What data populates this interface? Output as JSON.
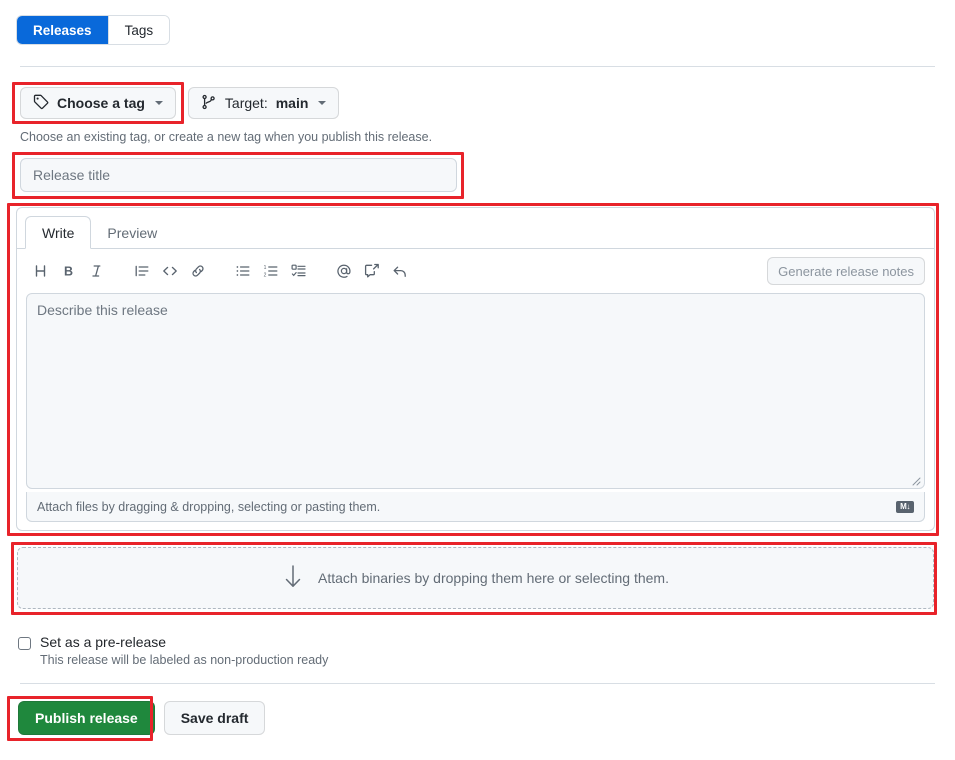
{
  "nav_tabs": [
    {
      "label": "Releases",
      "active": true
    },
    {
      "label": "Tags",
      "active": false
    }
  ],
  "tag_selector": {
    "label": "Choose a tag",
    "icon": "tag-icon",
    "caret": "chevron-down-icon"
  },
  "target_selector": {
    "prefix": "Target:",
    "value": "main",
    "icon": "git-branch-icon",
    "caret": "chevron-down-icon"
  },
  "tag_help_text": "Choose an existing tag, or create a new tag when you publish this release.",
  "release_title": {
    "placeholder": "Release title",
    "value": ""
  },
  "editor": {
    "tabs": [
      {
        "label": "Write",
        "active": true
      },
      {
        "label": "Preview",
        "active": false
      }
    ],
    "toolbar": [
      {
        "name": "heading-icon",
        "glyph": "H"
      },
      {
        "name": "bold-icon",
        "glyph": "B"
      },
      {
        "name": "italic-icon",
        "glyph": "I"
      },
      {
        "name": "quote-icon",
        "glyph": "quote"
      },
      {
        "name": "code-icon",
        "glyph": "<>"
      },
      {
        "name": "link-icon",
        "glyph": "link"
      },
      {
        "name": "unordered-list-icon",
        "glyph": "ul"
      },
      {
        "name": "ordered-list-icon",
        "glyph": "ol"
      },
      {
        "name": "task-list-icon",
        "glyph": "tasklist"
      },
      {
        "name": "mention-icon",
        "glyph": "@"
      },
      {
        "name": "reference-icon",
        "glyph": "reference"
      },
      {
        "name": "saved-reply-icon",
        "glyph": "reply"
      }
    ],
    "generate_notes_label": "Generate release notes",
    "body": {
      "placeholder": "Describe this release",
      "value": ""
    },
    "attach_files_text": "Attach files by dragging & dropping, selecting or pasting them.",
    "markdown_badge": "M↓"
  },
  "binaries_dropzone": {
    "icon": "download-arrow-icon",
    "text": "Attach binaries by dropping them here or selecting them."
  },
  "prerelease": {
    "checked": false,
    "label": "Set as a pre-release",
    "description": "This release will be labeled as non-production ready"
  },
  "footer": {
    "publish_label": "Publish release",
    "draft_label": "Save draft"
  },
  "colors": {
    "accent_blue": "#0969da",
    "success_green": "#1f883d",
    "annotation_red": "#e8232a",
    "border_grey": "#d0d7de",
    "muted_text": "#636c76",
    "canvas_subtle": "#f6f8fa"
  },
  "annotations": [
    {
      "name": "annotation-choose-tag"
    },
    {
      "name": "annotation-release-title"
    },
    {
      "name": "annotation-editor"
    },
    {
      "name": "annotation-binaries"
    },
    {
      "name": "annotation-publish"
    }
  ]
}
